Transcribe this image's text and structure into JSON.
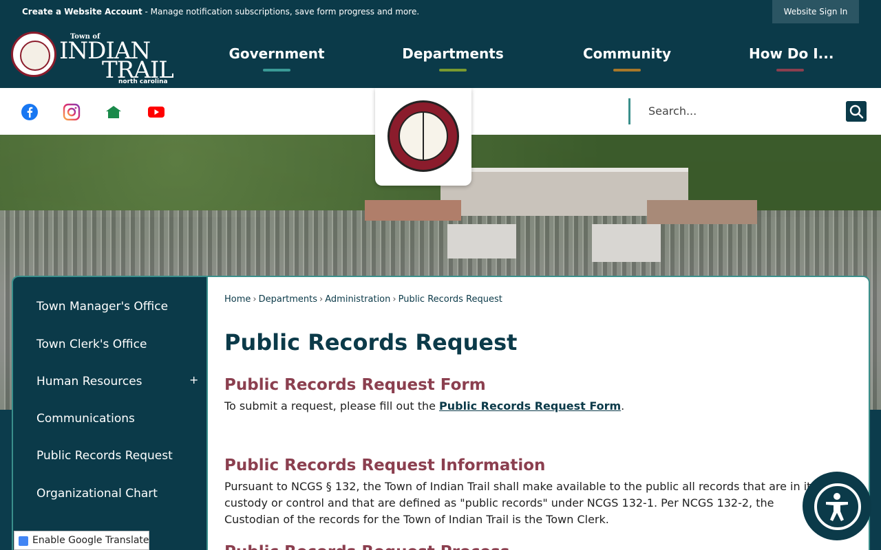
{
  "topbar": {
    "account_bold": "Create a Website Account",
    "account_text": " - Manage notification subscriptions, save form progress and more.",
    "sign_in": "Website Sign In"
  },
  "logo": {
    "town_of": "Town of",
    "indian": "INDIAN",
    "trail": "TRAIL",
    "state": "north carolina"
  },
  "nav": [
    {
      "label": "Government",
      "color": "#3a9a96"
    },
    {
      "label": "Departments",
      "color": "#7a9a2f"
    },
    {
      "label": "Community",
      "color": "#a8782a"
    },
    {
      "label": "How Do I...",
      "color": "#8b3f4f"
    }
  ],
  "social": [
    "facebook-icon",
    "instagram-icon",
    "nextdoor-icon",
    "youtube-icon"
  ],
  "search": {
    "placeholder": "Search..."
  },
  "sidebar": {
    "items": [
      {
        "label": "Town Manager's Office"
      },
      {
        "label": "Town Clerk's Office"
      },
      {
        "label": "Human Resources",
        "expand": "+"
      },
      {
        "label": "Communications"
      },
      {
        "label": "Public Records Request"
      },
      {
        "label": "Organizational Chart"
      }
    ]
  },
  "breadcrumb": [
    "Home",
    "Departments",
    "Administration",
    "Public Records Request"
  ],
  "breadcrumb_sep": "›",
  "main": {
    "title": "Public Records Request",
    "section1_heading": "Public Records Request Form",
    "section1_text_before": "To submit a request, please fill out the ",
    "section1_link": "Public Records Request Form",
    "section1_text_after": ".",
    "section2_heading": "Public Records Request Information",
    "section2_text": "Pursuant to NCGS § 132, the Town of Indian Trail shall make available to the public all records that are in its custody or control and that are defined as \"public records\" under NCGS 132-1. Per NCGS 132-2, the Custodian of the records for the Town of Indian Trail is the Town Clerk.",
    "section3_heading": "Public Records Request Process"
  },
  "translate": {
    "label": "Enable Google Translate"
  }
}
